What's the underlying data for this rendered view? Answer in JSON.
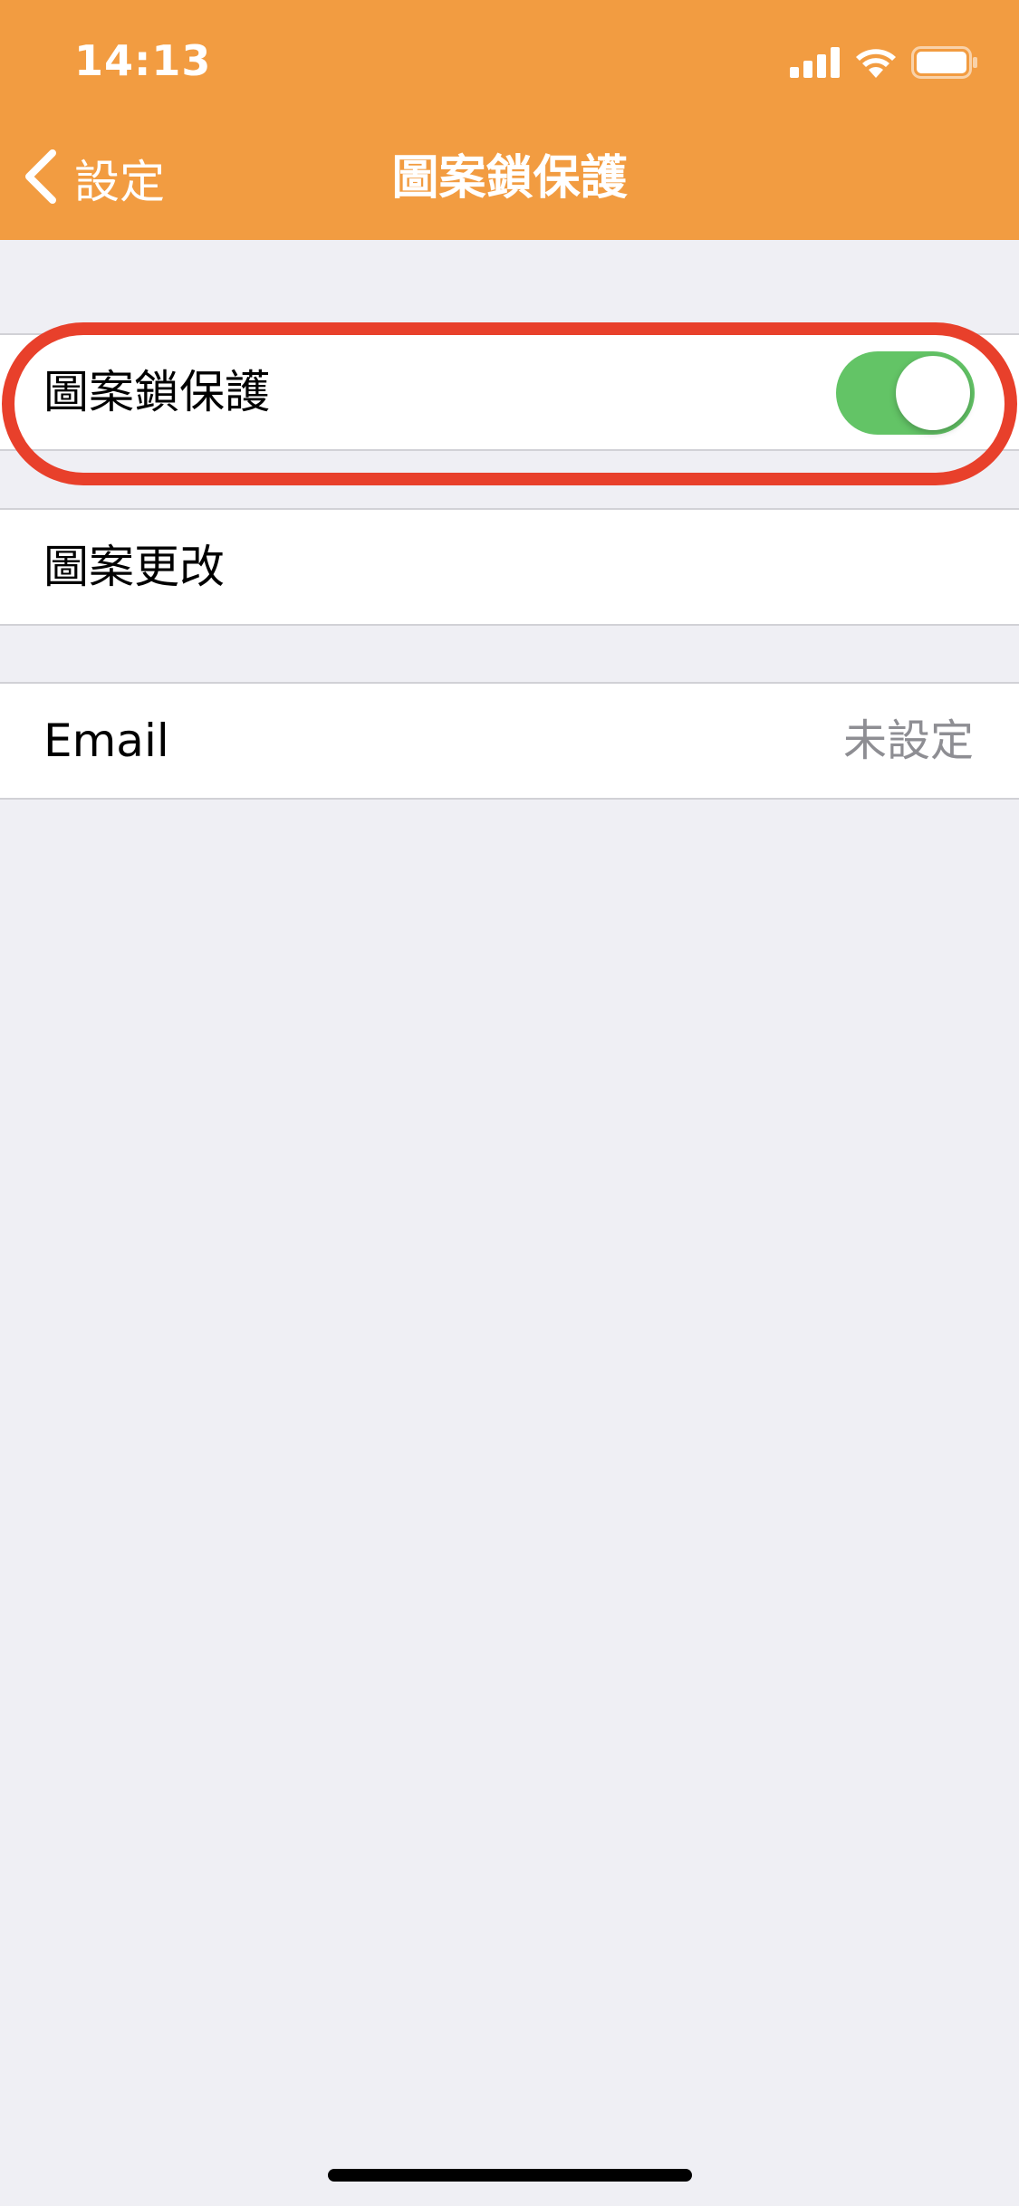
{
  "status_bar": {
    "time": "14:13",
    "icons": [
      "cellular-signal-icon",
      "wifi-icon",
      "battery-icon"
    ]
  },
  "nav": {
    "back_label": "設定",
    "title": "圖案鎖保護"
  },
  "cells": {
    "pattern_lock": {
      "label": "圖案鎖保護",
      "toggle_on": true
    },
    "change_pattern": {
      "label": "圖案更改"
    },
    "email": {
      "label": "Email",
      "value": "未設定"
    }
  },
  "colors": {
    "header": "#f29c41",
    "toggle_on": "#63c466",
    "highlight": "#e8402b",
    "background": "#efeff4"
  }
}
